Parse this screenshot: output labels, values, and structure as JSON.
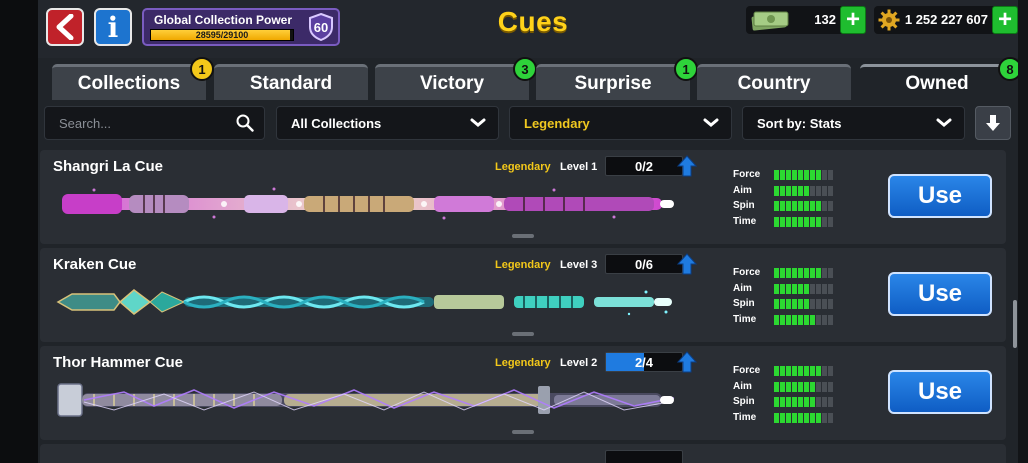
{
  "header": {
    "title": "Cues",
    "global_power_label": "Global Collection Power",
    "global_power_value": "28595/29100",
    "global_power_fraction": 0.98,
    "global_power_level": "60",
    "cash": "132",
    "coins": "1 252 227 607"
  },
  "tabs": [
    {
      "label": "Collections",
      "badge": "1",
      "badge_color": "yellow"
    },
    {
      "label": "Standard",
      "badge": ""
    },
    {
      "label": "Victory",
      "badge": "3",
      "badge_color": "green"
    },
    {
      "label": "Surprise",
      "badge": "1",
      "badge_color": "green"
    },
    {
      "label": "Country",
      "badge": ""
    },
    {
      "label": "Owned",
      "badge": "8",
      "badge_color": "green",
      "active": true
    }
  ],
  "filters": {
    "search_placeholder": "Search...",
    "collection": "All Collections",
    "rarity": "Legendary",
    "sort": "Sort by: Stats"
  },
  "stat_labels": [
    "Force",
    "Aim",
    "Spin",
    "Time"
  ],
  "cues": [
    {
      "name": "Shangri La Cue",
      "rarity": "Legendary",
      "level": "Level 1",
      "pieces": "0/2",
      "pieces_fraction": 0,
      "use_label": "Use",
      "stats": {
        "force": 8,
        "aim": 6,
        "spin": 8,
        "time": 8
      },
      "theme": "pink"
    },
    {
      "name": "Kraken Cue",
      "rarity": "Legendary",
      "level": "Level 3",
      "pieces": "0/6",
      "pieces_fraction": 0,
      "use_label": "Use",
      "stats": {
        "force": 8,
        "aim": 6,
        "spin": 6,
        "time": 7
      },
      "theme": "teal"
    },
    {
      "name": "Thor Hammer Cue",
      "rarity": "Legendary",
      "level": "Level 2",
      "pieces": "2/4",
      "pieces_fraction": 0.5,
      "use_label": "Use",
      "stats": {
        "force": 8,
        "aim": 7,
        "spin": 7,
        "time": 8
      },
      "theme": "violet"
    }
  ],
  "colors": {
    "title": "#ffd21a",
    "legendary": "#f3c81a",
    "stat_on": "#2cd831",
    "use_button": "#1d74dc"
  }
}
